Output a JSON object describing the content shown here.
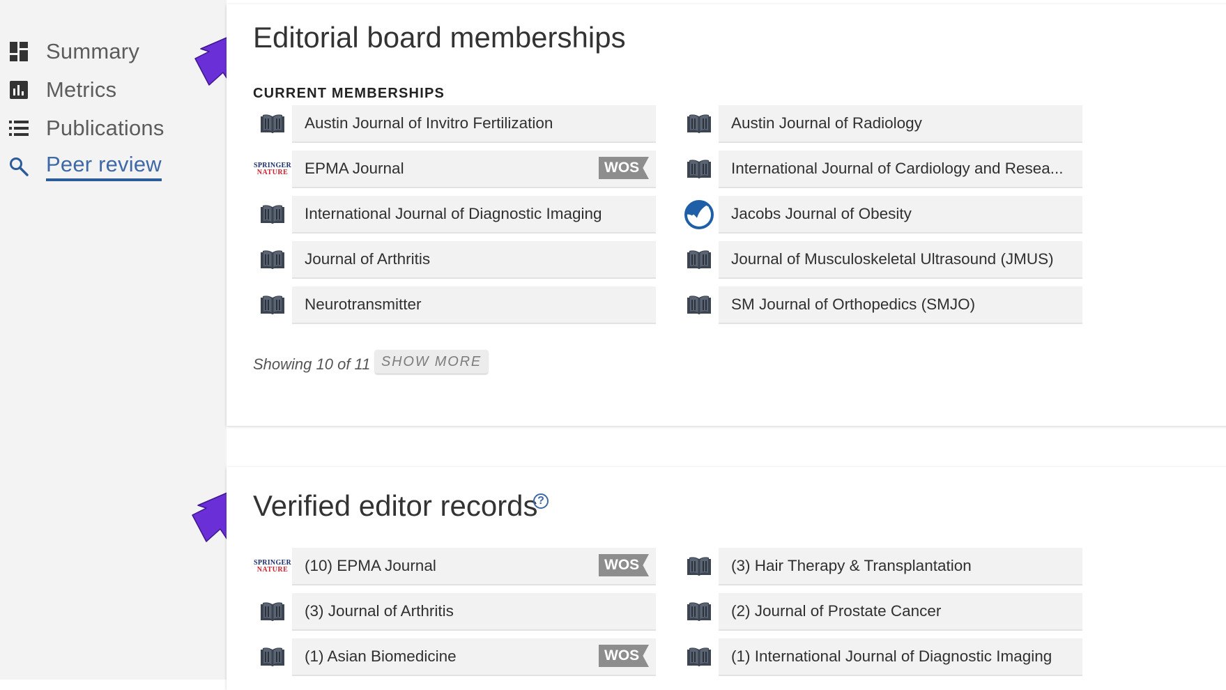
{
  "sidebar": {
    "items": [
      {
        "label": "Summary",
        "icon": "dashboard-icon"
      },
      {
        "label": "Metrics",
        "icon": "bar-chart-icon"
      },
      {
        "label": "Publications",
        "icon": "list-icon"
      },
      {
        "label": "Peer review",
        "icon": "search-icon",
        "active": true
      }
    ]
  },
  "editorial": {
    "title": "Editorial board memberships",
    "section_label": "CURRENT MEMBERSHIPS",
    "items": [
      {
        "name": "Austin Journal of Invitro Fertilization",
        "logo": "book-icon"
      },
      {
        "name": "Austin Journal of Radiology",
        "logo": "book-icon"
      },
      {
        "name": "EPMA Journal",
        "logo": "springer-nature-logo",
        "badge": "WOS"
      },
      {
        "name": "International Journal of Cardiology and Resea...",
        "logo": "book-icon"
      },
      {
        "name": "International Journal of Diagnostic Imaging",
        "logo": "book-icon"
      },
      {
        "name": "Jacobs Journal of Obesity",
        "logo": "jacobs-logo"
      },
      {
        "name": "Journal of Arthritis",
        "logo": "book-icon"
      },
      {
        "name": "Journal of Musculoskeletal Ultrasound (JMUS)",
        "logo": "book-icon"
      },
      {
        "name": "Neurotransmitter",
        "logo": "book-icon"
      },
      {
        "name": "SM Journal of Orthopedics (SMJO)",
        "logo": "book-icon"
      }
    ],
    "showing_text": "Showing 10 of 11",
    "show_more_label": "SHOW MORE"
  },
  "verified": {
    "title": "Verified editor records",
    "help_icon": "?",
    "items": [
      {
        "name": "(10) EPMA Journal",
        "logo": "springer-nature-logo",
        "badge": "WOS"
      },
      {
        "name": "(3) Hair Therapy & Transplantation",
        "logo": "book-icon"
      },
      {
        "name": "(3) Journal of Arthritis",
        "logo": "book-icon"
      },
      {
        "name": "(2) Journal of Prostate Cancer",
        "logo": "book-icon"
      },
      {
        "name": "(1) Asian Biomedicine",
        "logo": "book-icon",
        "badge": "WOS"
      },
      {
        "name": "(1) International Journal of Diagnostic Imaging",
        "logo": "book-icon"
      }
    ]
  },
  "logo_text": {
    "springer_top": "SPRINGER",
    "springer_bottom": "NATURE"
  },
  "colors": {
    "accent": "#2c5b9a",
    "arrow": "#6a2fd6",
    "badge": "#8d8d8d"
  }
}
